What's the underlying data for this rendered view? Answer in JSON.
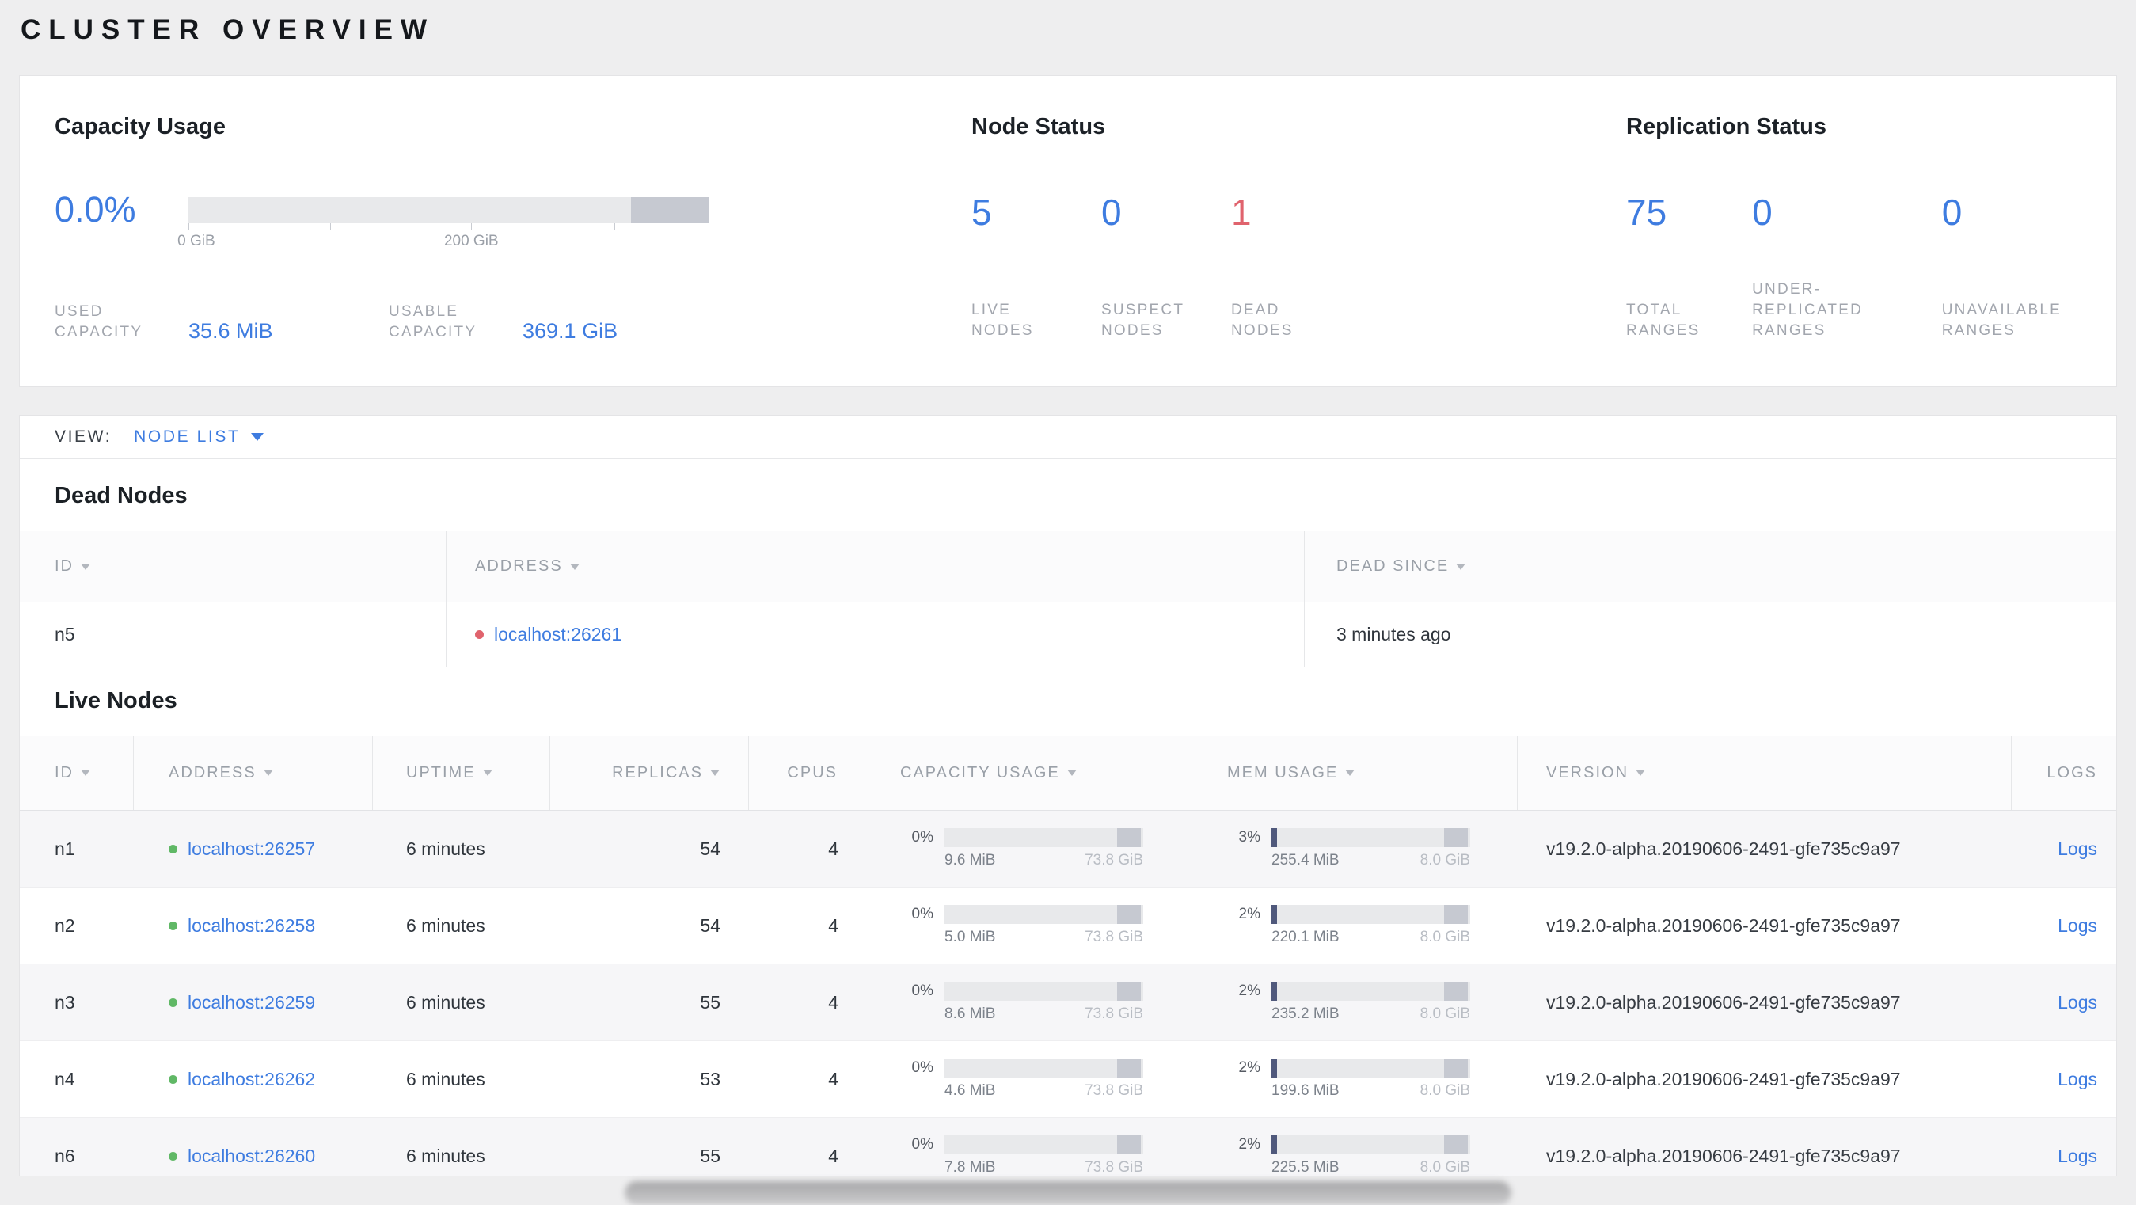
{
  "page_title": "CLUSTER OVERVIEW",
  "summary": {
    "capacity": {
      "heading": "Capacity Usage",
      "percent": "0.0%",
      "ticks": [
        {
          "label": "0 GiB"
        },
        {
          "label": "200 GiB"
        }
      ],
      "stats": [
        {
          "label": "USED CAPACITY",
          "value": "35.6 MiB"
        },
        {
          "label": "USABLE CAPACITY",
          "value": "369.1 GiB"
        }
      ]
    },
    "node_status": {
      "heading": "Node Status",
      "stats": [
        {
          "value": "5",
          "label": "LIVE NODES"
        },
        {
          "value": "0",
          "label": "SUSPECT NODES"
        },
        {
          "value": "1",
          "label": "DEAD NODES"
        }
      ]
    },
    "replication": {
      "heading": "Replication Status",
      "stats": [
        {
          "value": "75",
          "label": "TOTAL RANGES"
        },
        {
          "value": "0",
          "label": "UNDER-REPLICATED RANGES"
        },
        {
          "value": "0",
          "label": "UNAVAILABLE RANGES"
        }
      ]
    }
  },
  "view_bar": {
    "label": "VIEW:",
    "selected": "NODE LIST"
  },
  "dead_nodes": {
    "heading": "Dead Nodes",
    "columns": [
      "ID",
      "ADDRESS",
      "DEAD SINCE"
    ],
    "rows": [
      {
        "id": "n5",
        "address": "localhost:26261",
        "dead_since": "3 minutes ago"
      }
    ]
  },
  "live_nodes": {
    "heading": "Live Nodes",
    "columns": [
      "ID",
      "ADDRESS",
      "UPTIME",
      "REPLICAS",
      "CPUS",
      "CAPACITY USAGE",
      "MEM USAGE",
      "VERSION",
      "LOGS"
    ],
    "logs_label": "Logs",
    "rows": [
      {
        "id": "n1",
        "address": "localhost:26257",
        "uptime": "6 minutes",
        "replicas": "54",
        "cpus": "4",
        "capacity": {
          "pct": "0%",
          "used": "9.6 MiB",
          "total": "73.8 GiB"
        },
        "mem": {
          "pct": "3%",
          "used": "255.4 MiB",
          "total": "8.0 GiB"
        },
        "version": "v19.2.0-alpha.20190606-2491-gfe735c9a97"
      },
      {
        "id": "n2",
        "address": "localhost:26258",
        "uptime": "6 minutes",
        "replicas": "54",
        "cpus": "4",
        "capacity": {
          "pct": "0%",
          "used": "5.0 MiB",
          "total": "73.8 GiB"
        },
        "mem": {
          "pct": "2%",
          "used": "220.1 MiB",
          "total": "8.0 GiB"
        },
        "version": "v19.2.0-alpha.20190606-2491-gfe735c9a97"
      },
      {
        "id": "n3",
        "address": "localhost:26259",
        "uptime": "6 minutes",
        "replicas": "55",
        "cpus": "4",
        "capacity": {
          "pct": "0%",
          "used": "8.6 MiB",
          "total": "73.8 GiB"
        },
        "mem": {
          "pct": "2%",
          "used": "235.2 MiB",
          "total": "8.0 GiB"
        },
        "version": "v19.2.0-alpha.20190606-2491-gfe735c9a97"
      },
      {
        "id": "n4",
        "address": "localhost:26262",
        "uptime": "6 minutes",
        "replicas": "53",
        "cpus": "4",
        "capacity": {
          "pct": "0%",
          "used": "4.6 MiB",
          "total": "73.8 GiB"
        },
        "mem": {
          "pct": "2%",
          "used": "199.6 MiB",
          "total": "8.0 GiB"
        },
        "version": "v19.2.0-alpha.20190606-2491-gfe735c9a97"
      },
      {
        "id": "n6",
        "address": "localhost:26260",
        "uptime": "6 minutes",
        "replicas": "55",
        "cpus": "4",
        "capacity": {
          "pct": "0%",
          "used": "7.8 MiB",
          "total": "73.8 GiB"
        },
        "mem": {
          "pct": "2%",
          "used": "225.5 MiB",
          "total": "8.0 GiB"
        },
        "version": "v19.2.0-alpha.20190606-2491-gfe735c9a97"
      }
    ]
  },
  "colors": {
    "accent_blue": "#3e7ce0",
    "danger_red": "#e0636d",
    "live_green": "#60b866"
  }
}
